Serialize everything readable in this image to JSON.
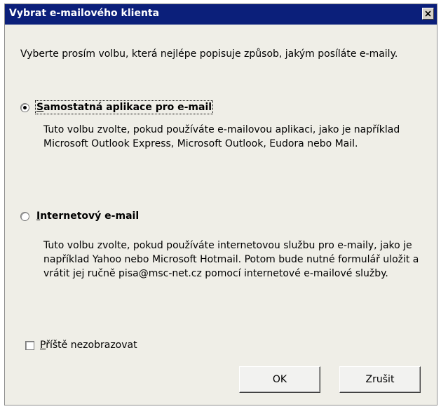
{
  "dialog": {
    "title": "Vybrat e-mailového klienta",
    "close_symbol": "close-icon"
  },
  "intro": "Vyberte prosím volbu, která nejlépe popisuje způsob, jakým posíláte e-maily.",
  "options": [
    {
      "mnemonic": "S",
      "label_rest": "amostatná aplikace pro e-mail",
      "checked": true,
      "description": "Tuto volbu zvolte, pokud používáte e-mailovou aplikaci, jako je například Microsoft Outlook Express, Microsoft Outlook, Eudora nebo Mail."
    },
    {
      "mnemonic": "I",
      "label_rest": "nternetový e-mail",
      "checked": false,
      "description": "Tuto volbu zvolte, pokud používáte internetovou službu pro e-maily, jako je například Yahoo nebo Microsoft Hotmail. Potom bude nutné formulář uložit a vrátit jej ručně pisa@msc-net.cz pomocí internetové e-mailové služby."
    }
  ],
  "dont_show": {
    "mnemonic": "P",
    "label_rest": "říště nezobrazovat",
    "checked": false
  },
  "buttons": {
    "ok": "OK",
    "cancel": "Zrušit"
  },
  "colors": {
    "titlebar": "#0b1f7a",
    "dialog_bg": "#efeee7"
  }
}
